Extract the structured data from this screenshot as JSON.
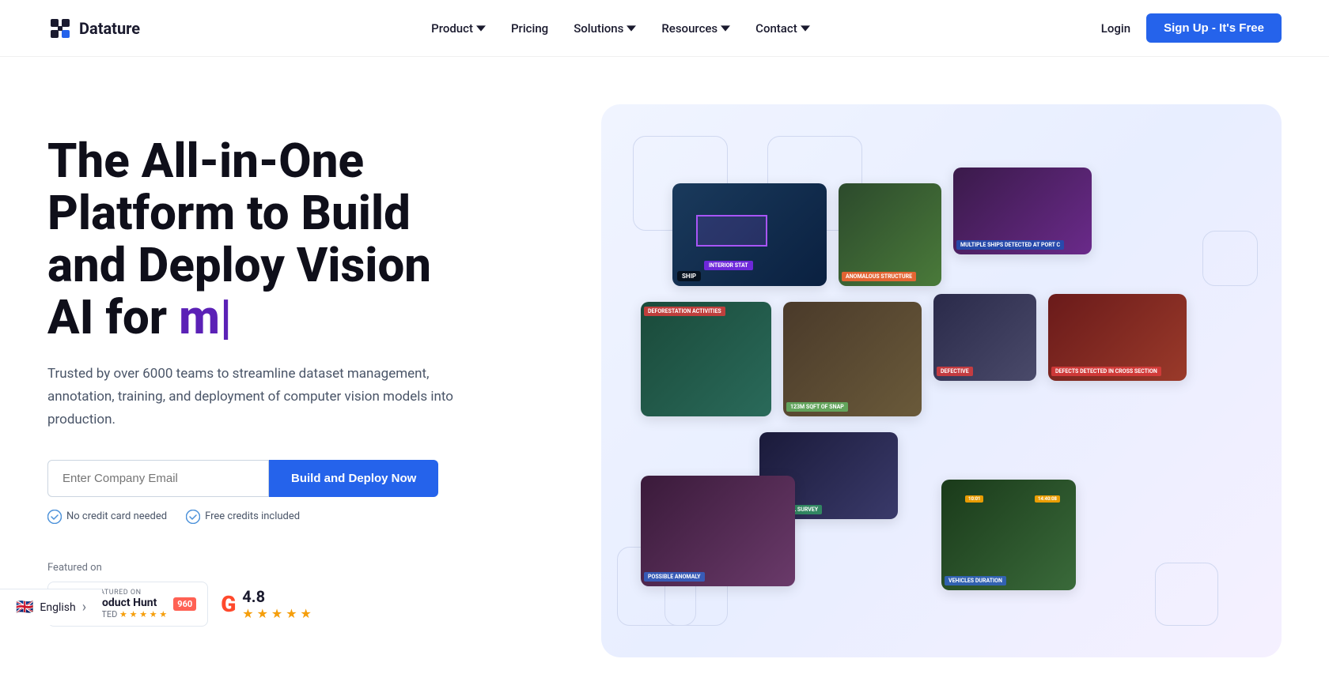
{
  "navbar": {
    "logo_text": "Datature",
    "nav_items": [
      {
        "label": "Product",
        "has_dropdown": true
      },
      {
        "label": "Pricing",
        "has_dropdown": false
      },
      {
        "label": "Solutions",
        "has_dropdown": true
      },
      {
        "label": "Resources",
        "has_dropdown": true
      },
      {
        "label": "Contact",
        "has_dropdown": true
      }
    ],
    "login_label": "Login",
    "signup_label": "Sign Up - It's Free"
  },
  "hero": {
    "heading_line1": "The All-in-One",
    "heading_line2": "Platform to Build",
    "heading_line3": "and Deploy Vision",
    "heading_line4_static": "AI for ",
    "heading_line4_highlight": "m|",
    "subtext": "Trusted by over 6000 teams to streamline dataset management, annotation, training, and deployment of computer vision models into production.",
    "email_placeholder": "Enter Company Email",
    "cta_label": "Build and Deploy Now",
    "trust_items": [
      {
        "label": "No credit card needed"
      },
      {
        "label": "Free credits included"
      }
    ],
    "featured_label": "Featured on",
    "ph_badge": {
      "featured_text": "FEATURED ON",
      "name": "Product Hunt",
      "rated_text": "RATED",
      "score": "960",
      "stars": "★ ★ ★ ★ ★"
    },
    "g2_badge": {
      "rating": "4.8",
      "stars": "★ ★ ★ ★ ★"
    }
  },
  "image_cards": [
    {
      "label": "SHIP",
      "class": "c1"
    },
    {
      "label": "ANOMALOUS STRUCTURE",
      "class": "c2"
    },
    {
      "label": "MULTIPLE SHIPS DETECTED AT PORT C",
      "class": "c3"
    },
    {
      "label": "DEFORESTATION ACTIVITIES",
      "class": "c4"
    },
    {
      "label": "123M SQFT OF SNAP",
      "class": "c5"
    },
    {
      "label": "DEFECTIVE",
      "class": "c6"
    },
    {
      "label": "DEFECTS DETECTED IN CROSS SECTION",
      "class": "c7"
    },
    {
      "label": "POTENTIAL SURVEY",
      "class": "c8"
    },
    {
      "label": "POSSIBLE ANOMALY",
      "class": "c9"
    },
    {
      "label": "VEHICLES DURATION",
      "class": "c10"
    }
  ],
  "language": {
    "flag": "🇬🇧",
    "label": "English",
    "chevron": "›"
  }
}
